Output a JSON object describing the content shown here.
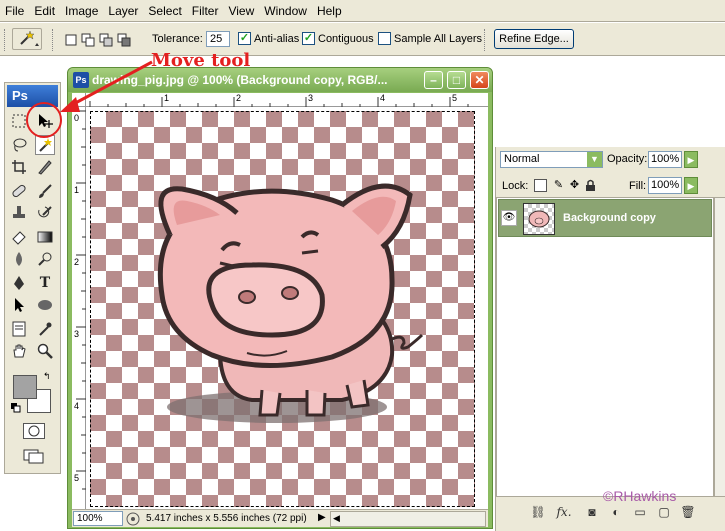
{
  "menu": [
    "File",
    "Edit",
    "Image",
    "Layer",
    "Select",
    "Filter",
    "View",
    "Window",
    "Help"
  ],
  "options": {
    "tolerance_label": "Tolerance:",
    "tolerance_value": "25",
    "anti_alias_label": "Anti-alias",
    "anti_alias_checked": true,
    "contiguous_label": "Contiguous",
    "contiguous_checked": true,
    "sample_all_label": "Sample All Layers",
    "sample_all_checked": false,
    "refine_edge_label": "Refine Edge..."
  },
  "toolbox": {
    "logo": "Ps",
    "foreground_color": "#a3a3a3",
    "background_color": "#ffffff"
  },
  "document": {
    "title": "drawing_pig.jpg @ 100% (Background copy, RGB/...",
    "icon_label": "Ps",
    "ruler_h": [
      "1",
      "2",
      "3",
      "4",
      "5"
    ],
    "ruler_v": [
      "0",
      "1",
      "2",
      "3",
      "4",
      "5"
    ],
    "zoom": "100%",
    "doc_size": "5.417 inches x 5.556 inches (72 ppi)"
  },
  "annotation": {
    "text": "Move tool",
    "color": "#e32020"
  },
  "layers": {
    "blend_mode": "Normal",
    "opacity_label": "Opacity:",
    "opacity_value": "100%",
    "lock_label": "Lock:",
    "fill_label": "Fill:",
    "fill_value": "100%",
    "items": [
      {
        "name": "Background copy",
        "visible": true,
        "selected": true
      }
    ]
  },
  "copyright": "©RHawkins"
}
